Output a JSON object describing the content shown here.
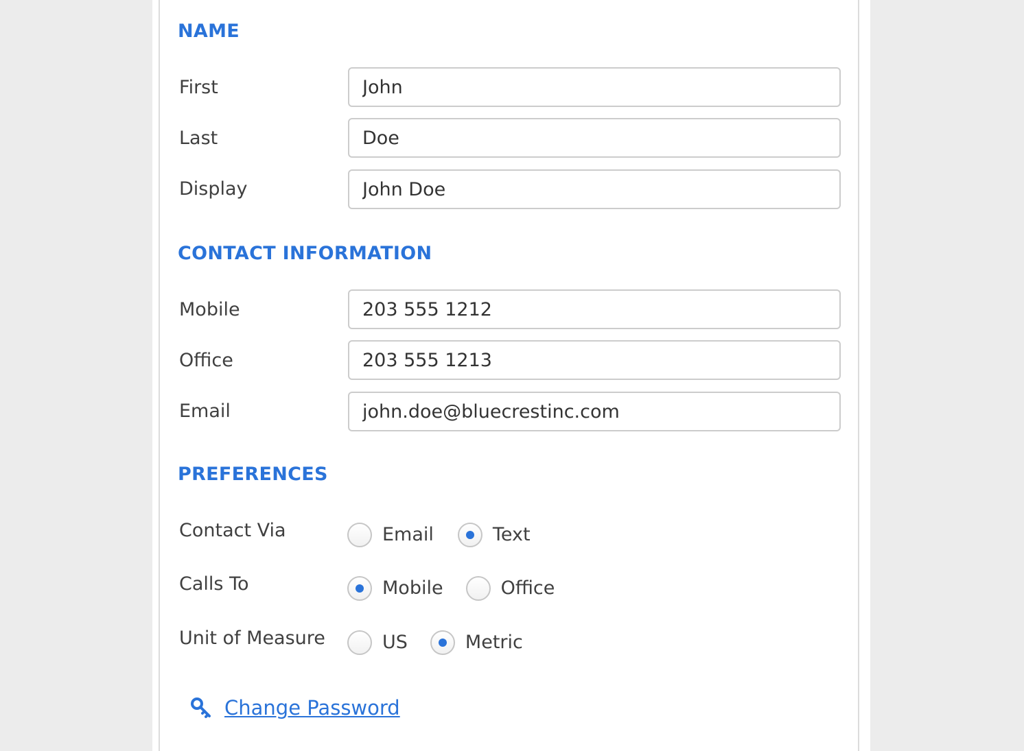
{
  "sections": {
    "name_title": "NAME",
    "contact_title": "CONTACT INFORMATION",
    "preferences_title": "PREFERENCES"
  },
  "name": {
    "first_label": "First",
    "first_value": "John",
    "last_label": "Last",
    "last_value": "Doe",
    "display_label": "Display",
    "display_value": "John Doe"
  },
  "contact": {
    "mobile_label": "Mobile",
    "mobile_value": "203 555 1212",
    "office_label": "Office",
    "office_value": "203 555 1213",
    "email_label": "Email",
    "email_value": "john.doe@bluecrestinc.com"
  },
  "preferences": {
    "contact_via": {
      "label": "Contact Via",
      "options": [
        "Email",
        "Text"
      ],
      "selected": "Text"
    },
    "calls_to": {
      "label": "Calls To",
      "options": [
        "Mobile",
        "Office"
      ],
      "selected": "Mobile"
    },
    "unit_of_measure": {
      "label": "Unit of Measure",
      "options": [
        "US",
        "Metric"
      ],
      "selected": "Metric"
    }
  },
  "change_password": {
    "label": "Change Password",
    "icon": "key-icon"
  },
  "colors": {
    "accent": "#2a73d9",
    "background": "#ececec",
    "panel": "#ffffff",
    "text": "#404040"
  }
}
